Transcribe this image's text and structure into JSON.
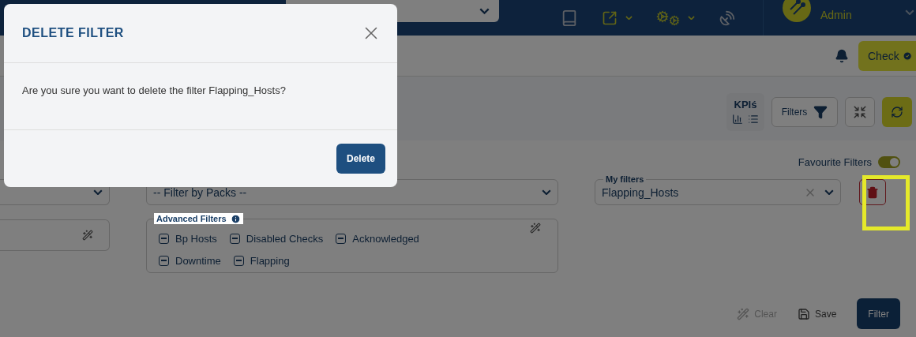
{
  "header": {
    "user": "Admin"
  },
  "toolbar": {
    "check_button": "Check"
  },
  "view_bar": {
    "kpis_label": "KPIś",
    "filters_button": "Filters"
  },
  "filter_panel": {
    "favourite": {
      "label": "Favourite Filters",
      "on": true
    },
    "packs": {
      "placeholder": "-- Filter by Packs --"
    },
    "advanced": {
      "label": "Advanced Filters",
      "options": [
        {
          "label": "Bp Hosts",
          "mixed": true
        },
        {
          "label": "Disabled Checks",
          "mixed": true
        },
        {
          "label": "Acknowledged",
          "mixed": true
        },
        {
          "label": "Downtime",
          "mixed": true
        },
        {
          "label": "Flapping",
          "mixed": true
        }
      ]
    },
    "my_filters": {
      "label": "My filters",
      "value": "Flapping_Hosts"
    },
    "delete_button": {
      "highlighted": true
    },
    "actions": [
      {
        "kind": "clear",
        "label": "Clear",
        "disabled": true
      },
      {
        "kind": "save",
        "label": "Save",
        "disabled": false
      },
      {
        "kind": "filter",
        "label": "Filter",
        "disabled": false
      }
    ]
  },
  "modal": {
    "title": "DELETE FILTER",
    "message": "Are you sure you want to delete the filter Flapping_Hosts?",
    "button": "Delete"
  }
}
